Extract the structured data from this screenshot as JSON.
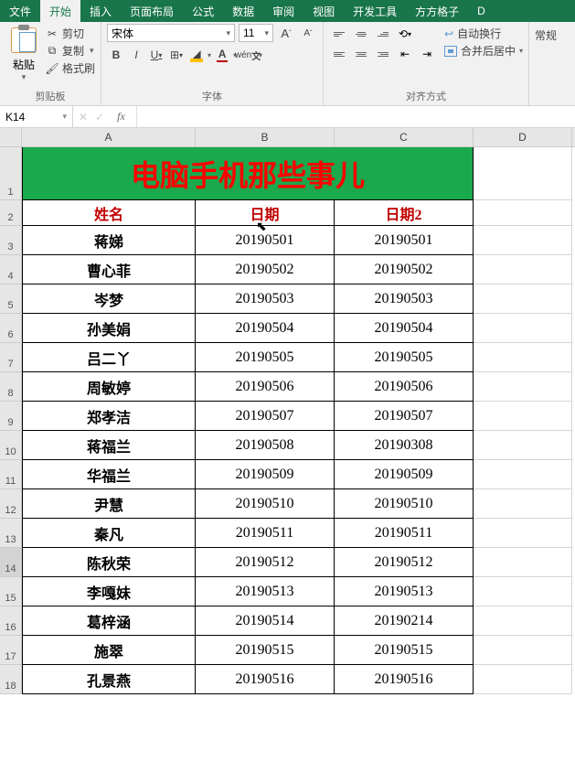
{
  "menu": {
    "file": "文件",
    "home": "开始",
    "insert": "插入",
    "layout": "页面布局",
    "formula": "公式",
    "data": "数据",
    "review": "审阅",
    "view": "视图",
    "dev": "开发工具",
    "square": "方方格子",
    "d": "D"
  },
  "ribbon": {
    "clipboard": {
      "label": "剪贴板",
      "cut": "剪切",
      "copy": "复制",
      "paint": "格式刷",
      "paste": "粘贴"
    },
    "font": {
      "label": "字体",
      "name": "宋体",
      "size": "11"
    },
    "align": {
      "label": "对齐方式",
      "wrap": "自动换行",
      "merge": "合并后居中"
    },
    "styles": {
      "label": "常规"
    }
  },
  "namebox": "K14",
  "fx": "",
  "columns": [
    "A",
    "B",
    "C",
    "D"
  ],
  "title": "电脑手机那些事儿",
  "headers": {
    "name": "姓名",
    "date1": "日期",
    "date2": "日期2"
  },
  "rows": [
    {
      "name": "蒋娣",
      "d1": "20190501",
      "d2": "20190501"
    },
    {
      "name": "曹心菲",
      "d1": "20190502",
      "d2": "20190502"
    },
    {
      "name": "岑梦",
      "d1": "20190503",
      "d2": "20190503"
    },
    {
      "name": "孙美娟",
      "d1": "20190504",
      "d2": "20190504"
    },
    {
      "name": "吕二丫",
      "d1": "20190505",
      "d2": "20190505"
    },
    {
      "name": "周敏婷",
      "d1": "20190506",
      "d2": "20190506"
    },
    {
      "name": "郑孝洁",
      "d1": "20190507",
      "d2": "20190507"
    },
    {
      "name": "蒋福兰",
      "d1": "20190508",
      "d2": "20190308"
    },
    {
      "name": "华福兰",
      "d1": "20190509",
      "d2": "20190509"
    },
    {
      "name": "尹慧",
      "d1": "20190510",
      "d2": "20190510"
    },
    {
      "name": "秦凡",
      "d1": "20190511",
      "d2": "20190511"
    },
    {
      "name": "陈秋荣",
      "d1": "20190512",
      "d2": "20190512"
    },
    {
      "name": "李嘎妹",
      "d1": "20190513",
      "d2": "20190513"
    },
    {
      "name": "葛梓涵",
      "d1": "20190514",
      "d2": "20190214"
    },
    {
      "name": "施翠",
      "d1": "20190515",
      "d2": "20190515"
    },
    {
      "name": "孔景燕",
      "d1": "20190516",
      "d2": "20190516"
    }
  ]
}
